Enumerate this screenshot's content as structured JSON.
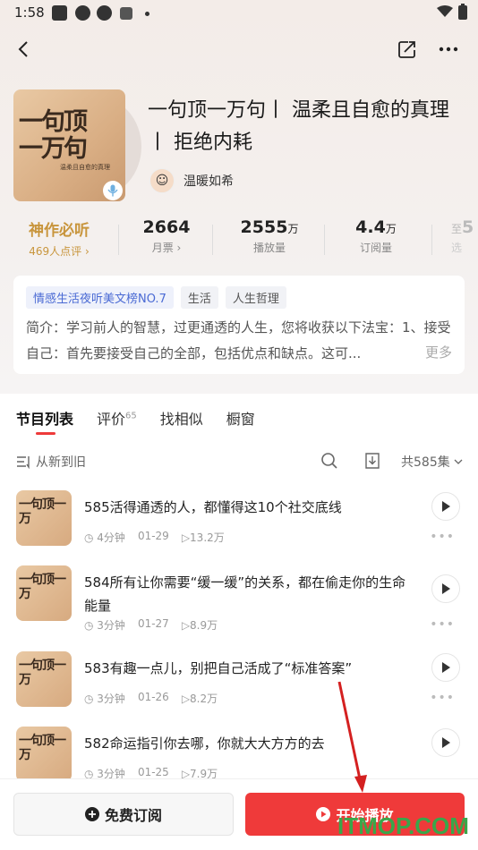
{
  "status": {
    "time": "1:58"
  },
  "album": {
    "title": "一句顶一万句丨 温柔且自愈的真理丨 拒绝内耗",
    "cover_big_text": "一句顶一万句",
    "cover_sub_text": "温柔且自愈的真理",
    "author": "温暖如希"
  },
  "stats": {
    "badge_main": "神作必听",
    "badge_sub": "469人点评 ›",
    "ticket_value": "2664",
    "ticket_label": "月票 ›",
    "plays_value": "2555",
    "plays_unit": "万",
    "plays_label": "播放量",
    "subs_value": "4.4",
    "subs_unit": "万",
    "subs_label": "订阅量",
    "extra_top": "至",
    "extra_value": "5",
    "extra_label": "选"
  },
  "tags": [
    "情感生活夜听美文榜NO.7",
    "生活",
    "人生哲理"
  ],
  "intro": "简介：学习前人的智慧，过更通透的人生，您将收获以下法宝：1、接受自己：首先要接受自己的全部，包括优点和缺点。这可...",
  "intro_more": "更多",
  "tabs": {
    "t1": "节目列表",
    "t2": "评价",
    "t2_count": "65",
    "t3": "找相似",
    "t4": "橱窗"
  },
  "toolbar": {
    "sort": "从新到旧",
    "total": "共585集"
  },
  "episodes": [
    {
      "title": "585活得通透的人，都懂得这10个社交底线",
      "duration": "4分钟",
      "date": "01-29",
      "plays": "13.2万"
    },
    {
      "title": "584所有让你需要“缓一缓”的关系，都在偷走你的生命能量",
      "duration": "3分钟",
      "date": "01-27",
      "plays": "8.9万"
    },
    {
      "title": "583有趣一点儿，别把自己活成了“标准答案”",
      "duration": "3分钟",
      "date": "01-26",
      "plays": "8.2万"
    },
    {
      "title": "582命运指引你去哪，你就大大方方的去",
      "duration": "3分钟",
      "date": "01-25",
      "plays": "7.9万"
    }
  ],
  "ep_cover_text": "一句顶一万",
  "buttons": {
    "subscribe": "免费订阅",
    "play": "开始播放"
  },
  "watermark": "ITMOP.COM",
  "colors": {
    "accent": "#ef3a3a",
    "gold": "#c8953c",
    "tag_blue": "#4a6ad4"
  }
}
